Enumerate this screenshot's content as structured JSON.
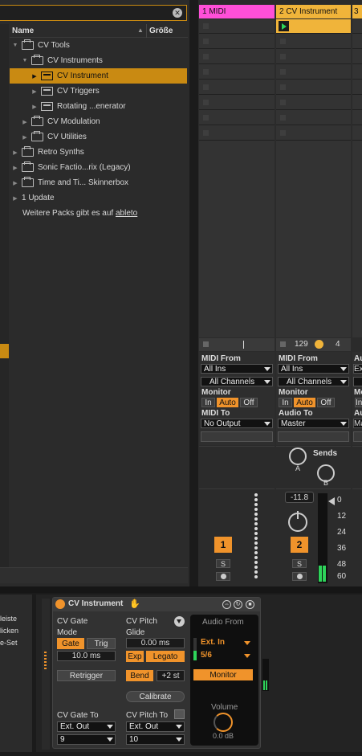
{
  "search": {
    "placeholder": ""
  },
  "browser": {
    "col_name": "Name",
    "col_size": "Größe",
    "items": [
      {
        "label": "CV Tools"
      },
      {
        "label": "CV Instruments"
      },
      {
        "label": "CV Instrument"
      },
      {
        "label": "CV Triggers"
      },
      {
        "label": "Rotating ...enerator"
      },
      {
        "label": "CV Modulation"
      },
      {
        "label": "CV Utilities"
      },
      {
        "label": "Retro Synths"
      },
      {
        "label": "Sonic Factio...rix (Legacy)"
      },
      {
        "label": "Time and Ti... Skinnerbox"
      },
      {
        "label": "1 Update"
      }
    ],
    "more_text": "Weitere Packs gibt es auf ",
    "more_link": "ableto"
  },
  "tracks": [
    {
      "name": "1 MIDI",
      "color": "#ff4fd8",
      "number": "1",
      "midi_from_label": "MIDI From",
      "midi_from": "All Ins",
      "channel": "All Channels",
      "monitor_label": "Monitor",
      "monitor_in": "In",
      "monitor_auto": "Auto",
      "monitor_off": "Off",
      "midi_to_label": "MIDI To",
      "midi_to": "No Output",
      "solo": "S"
    },
    {
      "name": "2 CV Instrument",
      "color": "#f0b43a",
      "number": "2",
      "midi_from_label": "MIDI From",
      "midi_from": "All Ins",
      "channel": "All Channels",
      "monitor_label": "Monitor",
      "monitor_in": "In",
      "monitor_auto": "Auto",
      "monitor_off": "Off",
      "audio_to_label": "Audio To",
      "audio_to": "Master",
      "solo": "S",
      "tempo": "129",
      "count": "4",
      "volume": "-11.8",
      "send_a": "A",
      "send_b": "B"
    },
    {
      "name": "3",
      "color": "#f0b43a",
      "partial_a": "Au",
      "partial_b": "Ex",
      "partial_c": "Mo",
      "partial_d": "In",
      "partial_e": "Au",
      "partial_f": "Ma"
    }
  ],
  "sends_label": "Sends",
  "meter_scale": [
    "0",
    "12",
    "24",
    "36",
    "48",
    "60"
  ],
  "left_partial": [
    "leiste",
    "licken",
    "e-Set"
  ],
  "device": {
    "title": "CV Instrument",
    "gate_section": "CV Gate",
    "mode_label": "Mode",
    "gate_btn": "Gate",
    "trig_btn": "Trig",
    "gate_time": "10.0 ms",
    "retrigger": "Retrigger",
    "gate_to_label": "CV Gate To",
    "gate_out": "Ext. Out",
    "gate_ch": "9",
    "pitch_section": "CV Pitch",
    "glide_label": "Glide",
    "glide_value": "0.00 ms",
    "exp_btn": "Exp",
    "legato_btn": "Legato",
    "bend_btn": "Bend",
    "bend_value": "+2 st",
    "calibrate": "Calibrate",
    "pitch_to_label": "CV Pitch To",
    "pitch_out": "Ext. Out",
    "pitch_ch": "10",
    "audio_from_label": "Audio From",
    "audio_from": "Ext. In",
    "audio_ch": "5/6",
    "monitor": "Monitor",
    "volume_label": "Volume",
    "volume_value": "0.0 dB"
  }
}
